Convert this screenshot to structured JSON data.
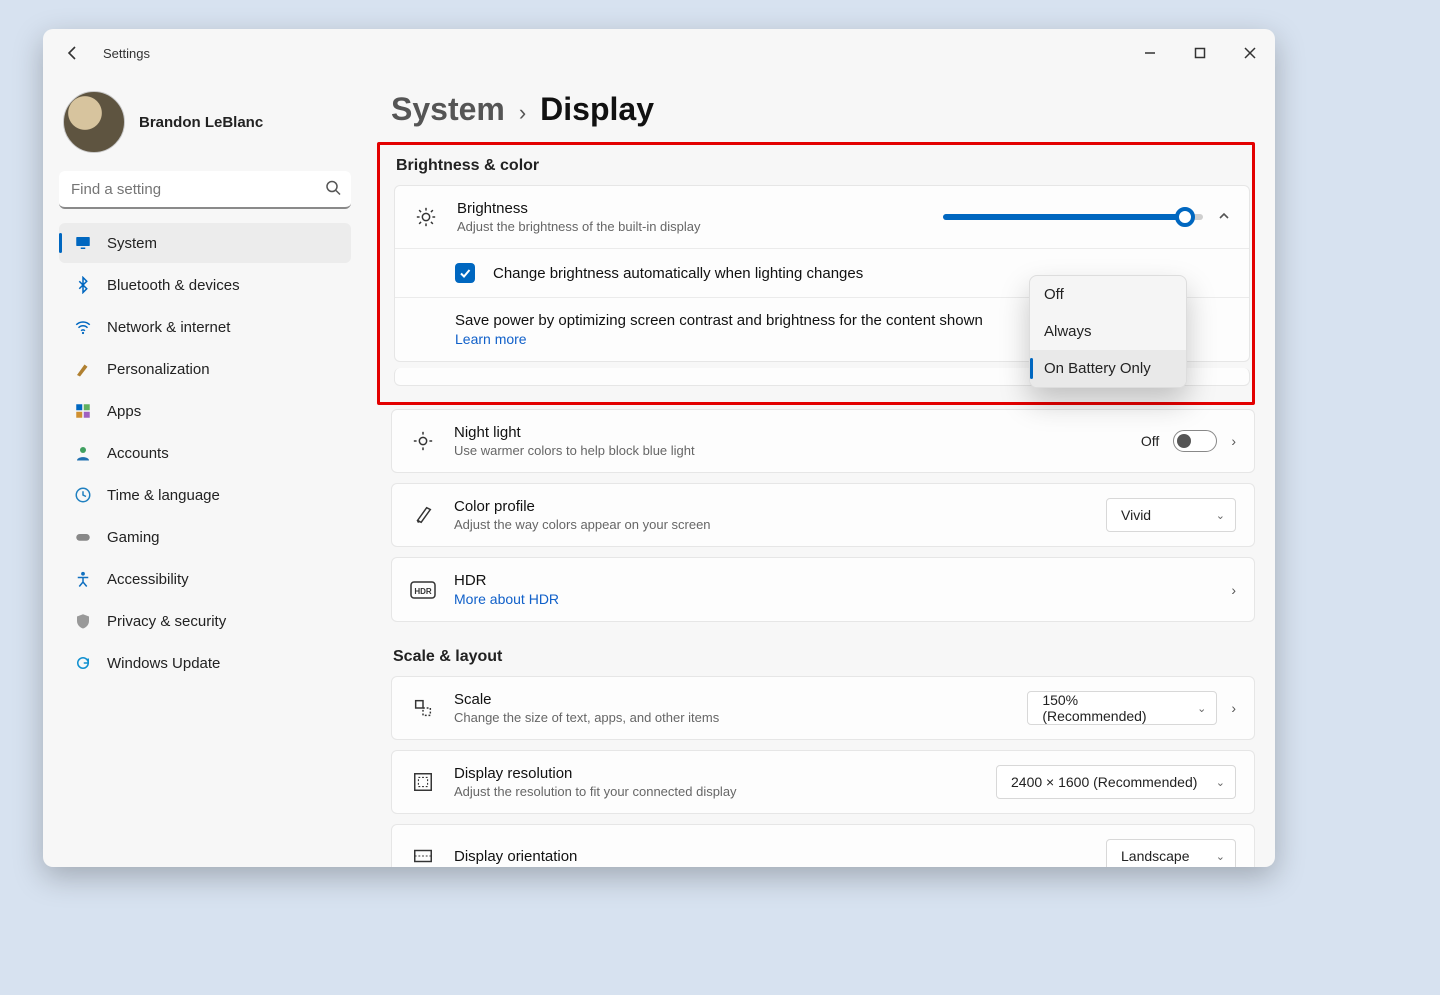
{
  "window": {
    "title": "Settings"
  },
  "account": {
    "name": "Brandon LeBlanc"
  },
  "search": {
    "placeholder": "Find a setting"
  },
  "sidebar": {
    "items": [
      {
        "label": "System",
        "icon": "monitor",
        "active": true
      },
      {
        "label": "Bluetooth & devices",
        "icon": "bluetooth",
        "active": false
      },
      {
        "label": "Network & internet",
        "icon": "wifi",
        "active": false
      },
      {
        "label": "Personalization",
        "icon": "brush",
        "active": false
      },
      {
        "label": "Apps",
        "icon": "apps",
        "active": false
      },
      {
        "label": "Accounts",
        "icon": "person",
        "active": false
      },
      {
        "label": "Time & language",
        "icon": "clock",
        "active": false
      },
      {
        "label": "Gaming",
        "icon": "gamepad",
        "active": false
      },
      {
        "label": "Accessibility",
        "icon": "access",
        "active": false
      },
      {
        "label": "Privacy & security",
        "icon": "shield",
        "active": false
      },
      {
        "label": "Windows Update",
        "icon": "sync",
        "active": false
      }
    ]
  },
  "breadcrumb": {
    "parent": "System",
    "current": "Display"
  },
  "brightness": {
    "section_title": "Brightness & color",
    "title": "Brightness",
    "subtitle": "Adjust the brightness of the built-in display",
    "slider_percent": 93,
    "auto_checkbox_label": "Change brightness automatically when lighting changes",
    "auto_checkbox_checked": true,
    "power_text": "Save power by optimizing screen contrast and brightness for the content shown",
    "learn_more": "Learn more",
    "dropdown": {
      "options": [
        {
          "label": "Off",
          "selected": false
        },
        {
          "label": "Always",
          "selected": false
        },
        {
          "label": "On Battery Only",
          "selected": true
        }
      ]
    }
  },
  "night_light": {
    "title": "Night light",
    "subtitle": "Use warmer colors to help block blue light",
    "state_label": "Off",
    "enabled": false
  },
  "color_profile": {
    "title": "Color profile",
    "subtitle": "Adjust the way colors appear on your screen",
    "value": "Vivid"
  },
  "hdr": {
    "title": "HDR",
    "link": "More about HDR"
  },
  "scale_layout": {
    "section_title": "Scale & layout",
    "scale": {
      "title": "Scale",
      "subtitle": "Change the size of text, apps, and other items",
      "value": "150% (Recommended)"
    },
    "resolution": {
      "title": "Display resolution",
      "subtitle": "Adjust the resolution to fit your connected display",
      "value": "2400 × 1600 (Recommended)"
    },
    "orientation": {
      "title": "Display orientation",
      "value": "Landscape"
    }
  }
}
